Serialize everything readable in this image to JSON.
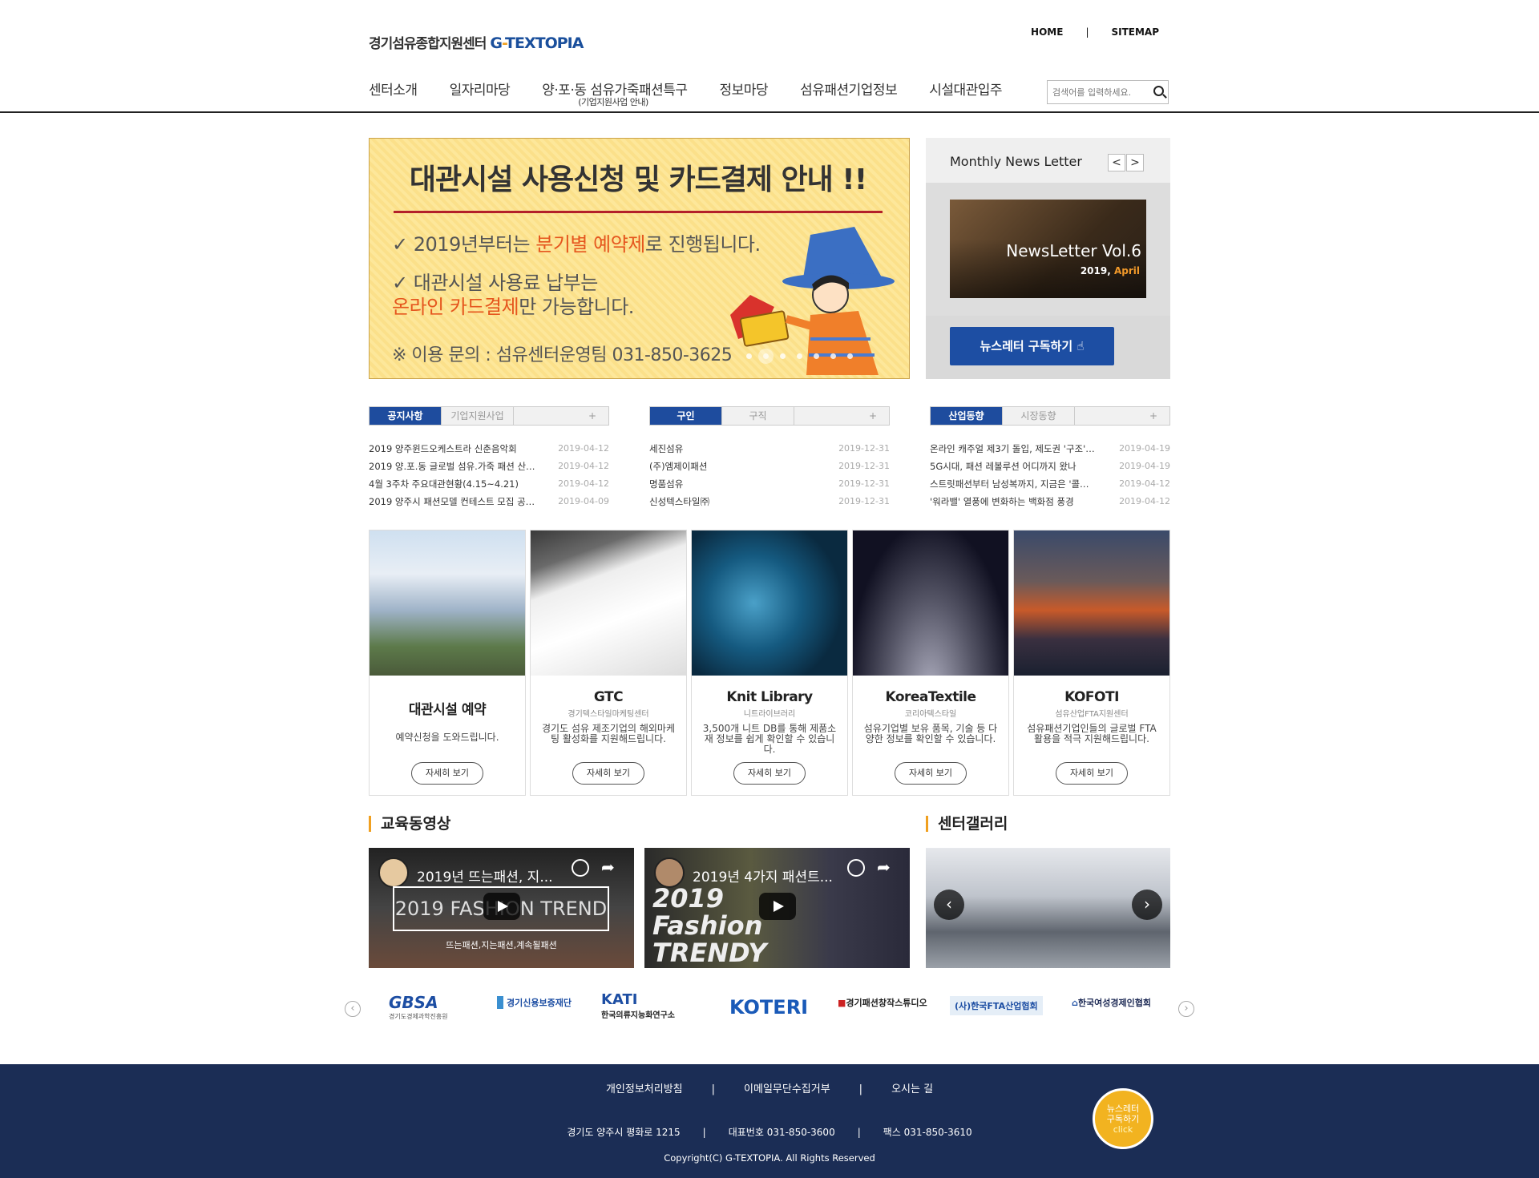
{
  "header": {
    "logo_kr": "경기섬유종합지원센터",
    "logo_en_g": "G",
    "logo_en_dash": "-",
    "logo_en_rest": "TEXTOPIA",
    "home": "HOME",
    "sep": "|",
    "sitemap": "SITEMAP"
  },
  "gnb": [
    "센터소개",
    "일자리마당",
    "양·포·동 섬유가죽패션특구",
    "정보마당",
    "섬유패션기업정보",
    "시설대관입주"
  ],
  "gnb_sub": "(기업지원사업 안내)",
  "search": {
    "placeholder": "검색어를 입력하세요."
  },
  "banner": {
    "title": "대관시설 사용신청 및 카드결제 안내 !!",
    "l1a": "✓ 2019년부터는 ",
    "l1b": "분기별 예약제",
    "l1c": "로 진행됩니다.",
    "l2": "✓ 대관시설 사용료 납부는",
    "l3a": "온라인 카드결제",
    "l3b": "만 가능합니다.",
    "l4": "※ 이용 문의 : 섬유센터운영팀 031-850-3625"
  },
  "news": {
    "title": "Monthly News Letter",
    "prev": "<",
    "next": ">",
    "pic_title": "NewsLetter Vol.6",
    "pic_year": "2019, ",
    "pic_month": "April",
    "subscribe": "뉴스레터 구독하기"
  },
  "boards": [
    {
      "tabs": [
        "공지사항",
        "기업지원사업"
      ],
      "plus": "+",
      "items": [
        [
          "2019 양주윈드오케스트라 신춘음악회",
          "2019-04-12"
        ],
        [
          "2019 양.포.동 글로벌 섬유.가죽 패션 산…",
          "2019-04-12"
        ],
        [
          "4월 3주차 주요대관현황(4.15~4.21)",
          "2019-04-12"
        ],
        [
          "2019 양주시 패션모델 컨테스트 모집 공…",
          "2019-04-09"
        ]
      ]
    },
    {
      "tabs": [
        "구인",
        "구직"
      ],
      "plus": "+",
      "items": [
        [
          "세진섬유",
          "2019-12-31"
        ],
        [
          "(주)엠제이패션",
          "2019-12-31"
        ],
        [
          "명품섬유",
          "2019-12-31"
        ],
        [
          "신성텍스타일㈜",
          "2019-12-31"
        ]
      ]
    },
    {
      "tabs": [
        "산업동향",
        "시장동향"
      ],
      "plus": "+",
      "items": [
        [
          "온라인 캐주얼 제3기 돌입, 제도권 '구조'…",
          "2019-04-19"
        ],
        [
          "5G시대, 패션 레볼루션 어디까지 왔나",
          "2019-04-19"
        ],
        [
          "스트릿패션부터 남성복까지, 지금은 '콜…",
          "2019-04-12"
        ],
        [
          "'워라밸' 열풍에 변화하는 백화점 풍경",
          "2019-04-12"
        ]
      ]
    }
  ],
  "cards": [
    {
      "title": "대관시설 예약",
      "kr": "",
      "desc": "예약신청을 도와드립니다.",
      "btn": "자세히 보기"
    },
    {
      "title": "GTC",
      "kr": "경기텍스타일마케팅센터",
      "desc": "경기도 섬유 제조기업의 해외마케팅 활성화를 지원해드립니다.",
      "btn": "자세히 보기"
    },
    {
      "title": "Knit Library",
      "kr": "니트라이브러리",
      "desc": "3,500개 니트 DB를 통해 제품소재 정보를 쉽게 확인할 수 있습니다.",
      "btn": "자세히 보기"
    },
    {
      "title": "KoreaTextile",
      "kr": "코리아텍스타일",
      "desc": "섬유기업별 보유 품목, 기술 등 다양한 정보를 확인할 수 있습니다.",
      "btn": "자세히 보기"
    },
    {
      "title": "KOFOTI",
      "kr": "섬유산업FTA지원센터",
      "desc": "섬유패션기업인들의 글로벌 FTA 활용을 적극 지원해드립니다.",
      "btn": "자세히 보기"
    }
  ],
  "edu": {
    "title": "교육동영상",
    "v1": "2019년 뜨는패션, 지...",
    "v1_big": "2019 FASHION TREND",
    "v1_cap": "뜨는패션,지는패션,계속될패션",
    "v2": "2019년 4가지 패션트...",
    "v2_big": "2019 Fashion TRENDY"
  },
  "gallery": {
    "title": "센터갤러리",
    "prev": "‹",
    "next": "›"
  },
  "partners": [
    "GBSA",
    "경기신용보증재단",
    "KATI",
    "KOTERI",
    "경기패션창작스튜디오",
    "(사)한국FTA산업협회",
    "한국여성경제인협회"
  ],
  "partners_sub": {
    "gbsa": "경기도경제과학진흥원",
    "kati": "한국의류지능화연구소"
  },
  "footer": {
    "links": [
      "개인정보처리방침",
      "|",
      "이메일무단수집거부",
      "|",
      "오시는 길"
    ],
    "addr": [
      "경기도 양주시 평화로 1215",
      "|",
      "대표번호 031-850-3600",
      "|",
      "팩스 031-850-3610"
    ],
    "copy": "Copyright(C) G-TEXTOPIA. All Rights Reserved",
    "badge1": "뉴스레터",
    "badge2": "구독하기",
    "badge3": "click"
  },
  "colors": {
    "brand": "#1d4ea3",
    "accent": "#f0a020",
    "footer": "#1b2d55"
  }
}
